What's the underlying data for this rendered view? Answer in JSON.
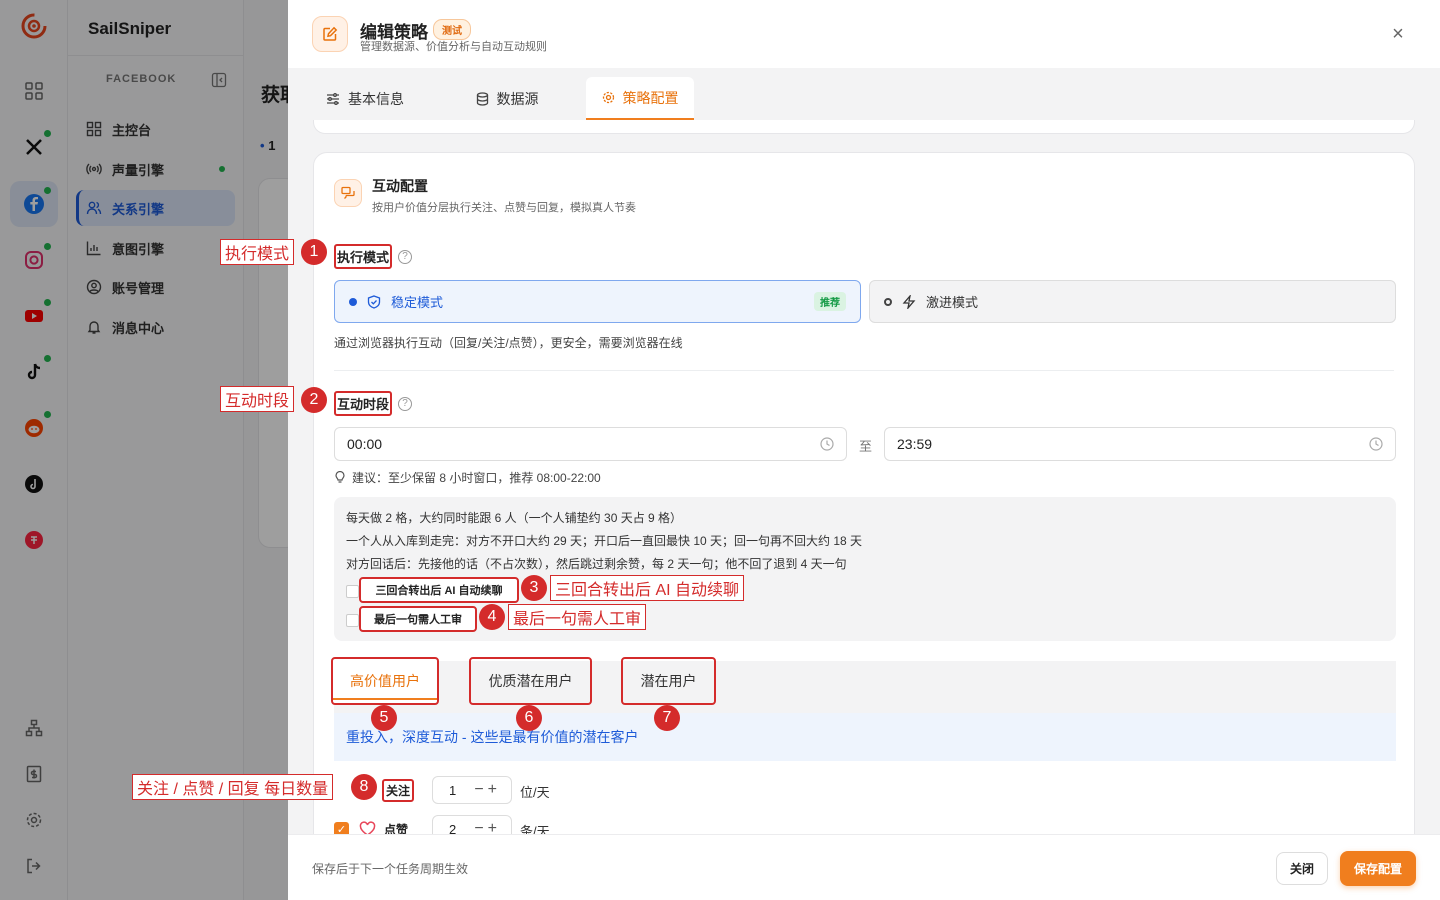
{
  "app": {
    "brand": "SailSniper",
    "section": "FACEBOOK",
    "nav": [
      {
        "label": "主控台",
        "icon": "dashboard-icon"
      },
      {
        "label": "声量引擎",
        "icon": "broadcast-icon"
      },
      {
        "label": "关系引擎",
        "icon": "users-icon"
      },
      {
        "label": "意图引擎",
        "icon": "chart-icon"
      },
      {
        "label": "账号管理",
        "icon": "account-icon"
      },
      {
        "label": "消息中心",
        "icon": "bell-icon"
      }
    ],
    "page_title_partial": "获取",
    "count_partial": "1",
    "colors": {
      "accent": "#f07e1e",
      "primary": "#1e5bd8",
      "online": "#22b550",
      "annotation": "#d42b2b"
    }
  },
  "drawer": {
    "title": "编辑策略",
    "badge": "测试",
    "subtitle": "管理数据源、价值分析与自动互动规则",
    "tabs": [
      {
        "label": "基本信息",
        "icon": "sliders-icon"
      },
      {
        "label": "数据源",
        "icon": "database-icon"
      },
      {
        "label": "策略配置",
        "icon": "gear-icon"
      }
    ],
    "section": {
      "title": "互动配置",
      "subtitle": "按用户价值分层执行关注、点赞与回复，模拟真人节奏",
      "exec_mode_label": "执行模式",
      "modes": [
        {
          "label": "稳定模式",
          "badge": "推荐"
        },
        {
          "label": "激进模式"
        }
      ],
      "mode_desc": "通过浏览器执行互动（回复/关注/点赞），更安全，需要浏览器在线",
      "time_label": "互动时段",
      "time_start": "00:00",
      "time_sep": "至",
      "time_end": "23:59",
      "tip": "建议：至少保留 8 小时窗口，推荐 08:00-22:00",
      "info_lines": [
        "每天做 2 格，大约同时能跟 6 人（一个人铺垫约 30 天占 9 格）",
        "一个人从入库到走完：对方不开口大约 29 天；开口后一直回最快 10 天；回一句再不回大约 18 天",
        "对方回话后：先接他的话（不占次数），然后跳过剩余赞，每 2 天一句；他不回了退到 4 天一句"
      ],
      "options": [
        "三回合转出后 AI 自动续聊",
        "最后一句需人工审"
      ],
      "tiers": [
        "高价值用户",
        "优质潜在用户",
        "潜在用户"
      ],
      "tier_desc": "重投入，深度互动 - 这些是最有价值的潜在客户",
      "quotas": [
        {
          "label": "关注",
          "value": "1",
          "unit": "位/天"
        },
        {
          "label": "点赞",
          "value": "2",
          "unit": "条/天"
        }
      ]
    },
    "footer_note": "保存后于下一个任务周期生效",
    "close_label": "关闭",
    "save_label": "保存配置"
  },
  "annotations": [
    {
      "num": "1",
      "text": "执行模式"
    },
    {
      "num": "2",
      "text": "互动时段"
    },
    {
      "num": "3",
      "text": "三回合转出后 AI 自动续聊"
    },
    {
      "num": "4",
      "text": "最后一句需人工审"
    },
    {
      "num": "5"
    },
    {
      "num": "6"
    },
    {
      "num": "7"
    },
    {
      "num": "8",
      "text": "关注 / 点赞 / 回复 每日数量"
    }
  ]
}
